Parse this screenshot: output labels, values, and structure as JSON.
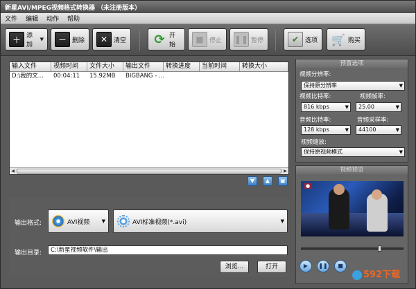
{
  "window": {
    "title": "新星AVI/MPEG视频格式转换器 （未注册版本）"
  },
  "menu": [
    "文件",
    "编辑",
    "动作",
    "帮助"
  ],
  "toolbar": {
    "add": "添加",
    "delete": "删除",
    "clear": "清空",
    "start": "开始",
    "stop": "停止",
    "pause": "暂停",
    "options": "选项",
    "buy": "购买"
  },
  "file_list": {
    "columns": [
      "输入文件",
      "视频时间",
      "文件大小",
      "输出文件",
      "转换进度",
      "当前时间",
      "转换大小"
    ],
    "rows": [
      [
        "D:\\我的文...",
        "00:04:11",
        "15.92MB",
        "BIGBANG - ...",
        "",
        "",
        ""
      ]
    ]
  },
  "output": {
    "format_label": "输出格式:",
    "format_category": "AVI视频",
    "format_profile": "AVI标准视频(*.avi)",
    "dir_label": "输出目录:",
    "dir_value": "C:\\新星视频软件\\输出",
    "browse": "浏览...",
    "open": "打开"
  },
  "presets": {
    "title": "预置选项",
    "resolution_label": "视频分辨率:",
    "resolution_value": "保持原分辨率",
    "vbitrate_label": "视频比特率:",
    "vbitrate_value": "816 kbps",
    "framerate_label": "视频帧率:",
    "framerate_value": "25.00",
    "abitrate_label": "音频比特率:",
    "abitrate_value": "128 kbps",
    "samplerate_label": "音频采样率:",
    "samplerate_value": "44100",
    "scale_label": "视频缩放:",
    "scale_value": "保持原视频模式"
  },
  "preview": {
    "title": "视频预览"
  },
  "watermark": "592下载"
}
